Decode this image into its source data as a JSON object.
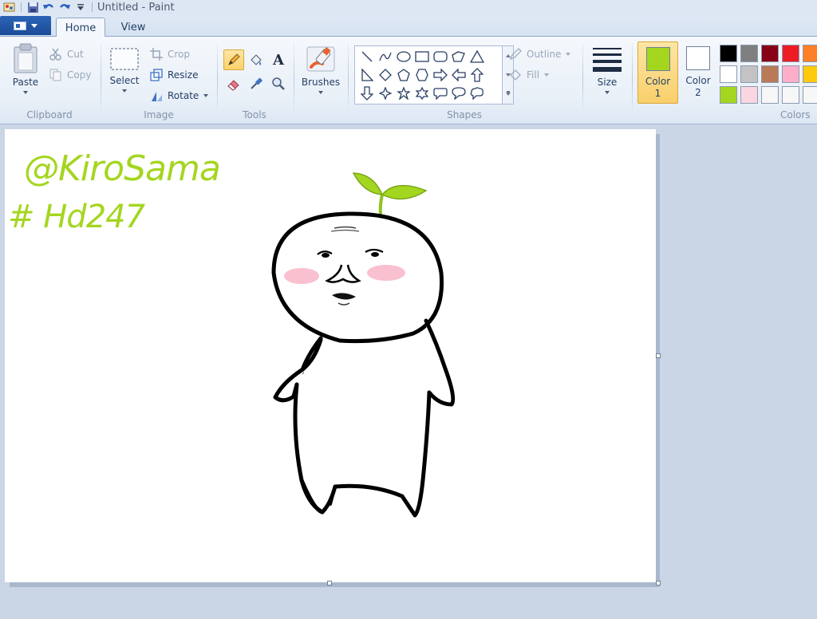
{
  "window": {
    "title": "Untitled - Paint"
  },
  "tabs": [
    {
      "label": "Home",
      "active": true
    },
    {
      "label": "View",
      "active": false
    }
  ],
  "ribbon": {
    "clipboard": {
      "group_label": "Clipboard",
      "paste_label": "Paste",
      "cut_label": "Cut",
      "copy_label": "Copy"
    },
    "image": {
      "group_label": "Image",
      "select_label": "Select",
      "crop_label": "Crop",
      "resize_label": "Resize",
      "rotate_label": "Rotate"
    },
    "tools": {
      "group_label": "Tools",
      "text_tool_glyph": "A"
    },
    "brushes": {
      "label": "Brushes"
    },
    "shapes": {
      "group_label": "Shapes",
      "outline_label": "Outline",
      "fill_label": "Fill"
    },
    "size": {
      "label": "Size"
    },
    "colors": {
      "group_label": "Colors",
      "color1_label": "Color",
      "color1_sub": "1",
      "color2_label": "Color",
      "color2_sub": "2",
      "color1_value": "#a4d620",
      "color2_value": "#ffffff",
      "palette": [
        "#000000",
        "#7f7f7f",
        "#880015",
        "#ed1c24",
        "#ff7f27",
        "#ffffff",
        "#c3c3c3",
        "#b97a57",
        "#ffaec9",
        "#ffc90e",
        "#a4d620",
        "#fad7e0",
        "#f7f7f7",
        "#f7f7f7",
        "#f7f7f7"
      ]
    }
  },
  "canvas": {
    "text_line1": "@KiroSama",
    "text_line2": "# Hd247",
    "ink_color": "#a4d620"
  }
}
